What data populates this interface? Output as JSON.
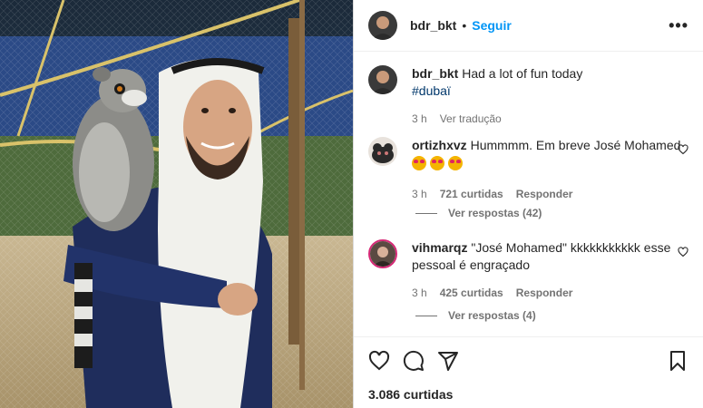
{
  "post": {
    "username": "bdr_bkt",
    "separator": "•",
    "follow_label": "Seguir",
    "more_label": "•••"
  },
  "caption": {
    "username": "bdr_bkt",
    "text": "Had a lot of fun today",
    "hashtag": "#dubaï",
    "time": "3 h",
    "translate_label": "Ver tradução"
  },
  "comments": [
    {
      "username": "ortizhxvz",
      "text": "Hummmm. Em breve José Mohamed",
      "emoji_count": 3,
      "time": "3 h",
      "likes": "721 curtidas",
      "reply_label": "Responder",
      "view_replies": "Ver respostas (42)"
    },
    {
      "username": "vihmarqz",
      "text": "\"José Mohamed\" kkkkkkkkkkk esse pessoal é engraçado",
      "time": "3 h",
      "likes": "425 curtidas",
      "reply_label": "Responder",
      "view_replies": "Ver respostas (4)"
    }
  ],
  "footer": {
    "likes": "3.086 curtidas"
  },
  "icons": [
    "heart-icon",
    "comment-icon",
    "share-icon",
    "bookmark-icon",
    "more-icon"
  ],
  "colors": {
    "follow": "#0095f6",
    "hashtag": "#00376b",
    "muted": "#737373"
  }
}
